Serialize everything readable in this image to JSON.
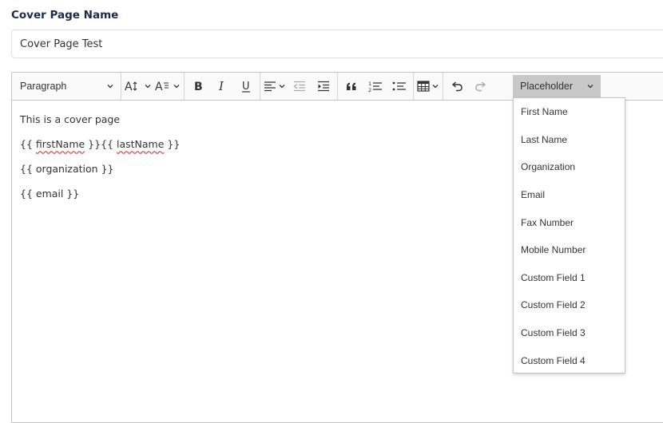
{
  "form": {
    "name_label": "Cover Page Name",
    "name_value": "Cover Page Test"
  },
  "toolbar": {
    "heading_select": "Paragraph",
    "placeholder_select": "Placeholder",
    "icons": [
      "font-size-icon",
      "font-family-icon",
      "bold-icon",
      "italic-icon",
      "underline-icon",
      "align-icon",
      "outdent-icon",
      "indent-icon",
      "blockquote-icon",
      "numbered-list-icon",
      "bulleted-list-icon",
      "table-icon",
      "undo-icon",
      "redo-icon"
    ]
  },
  "editor": {
    "lines": [
      "This is a cover page",
      "{{ firstName }}{{ lastName }}",
      "{{ organization }}",
      "{{ email }}"
    ],
    "tokens": {
      "open": "{{ ",
      "first": "firstName",
      "mid": " }}{{ ",
      "last": "lastName",
      "close": " }}"
    }
  },
  "placeholder_menu": {
    "items": [
      "First Name",
      "Last Name",
      "Organization",
      "Email",
      "Fax Number",
      "Mobile Number",
      "Custom Field 1",
      "Custom Field 2",
      "Custom Field 3",
      "Custom Field 4"
    ]
  },
  "colors": {
    "label": "#1e2a4a",
    "spellcheck": "#d9534f",
    "placeholder_bg": "#c8c8c8"
  }
}
